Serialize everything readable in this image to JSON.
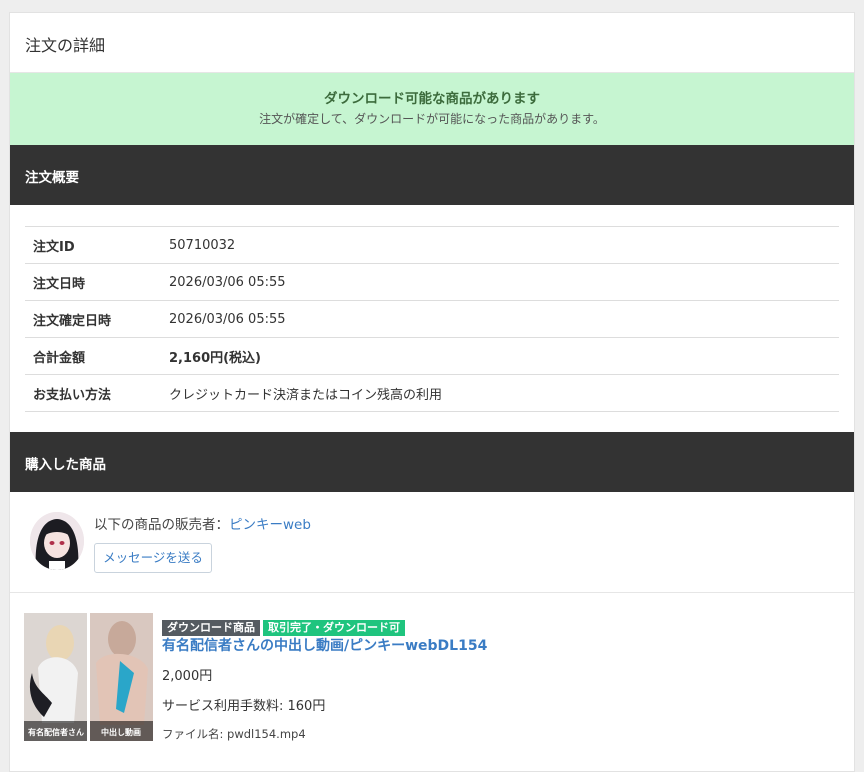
{
  "page": {
    "title": "注文の詳細"
  },
  "alert": {
    "title": "ダウンロード可能な商品があります",
    "body": "注文が確定して、ダウンロードが可能になった商品があります。",
    "background": "#c6f5d1"
  },
  "summary": {
    "header": "注文概要",
    "rows": [
      {
        "label": "注文ID",
        "value": "50710032"
      },
      {
        "label": "注文日時",
        "value": "2026/03/06 05:55"
      },
      {
        "label": "注文確定日時",
        "value": "2026/03/06 05:55"
      },
      {
        "label": "合計金額",
        "value": "2,160円(税込)"
      },
      {
        "label": "お支払い方法",
        "value": "クレジットカード決済またはコイン残高の利用"
      }
    ]
  },
  "purchased": {
    "header": "購入した商品",
    "seller_prefix": "以下の商品の販売者：",
    "seller_name": "ピンキーweb",
    "message_button": "メッセージを送る",
    "product": {
      "badges": [
        "ダウンロード商品",
        "取引完了・ダウンロード可"
      ],
      "thumb_captions": [
        "有名配信者さん",
        "中出し動画"
      ],
      "title": "有名配信者さんの中出し動画/ピンキーwebDL154",
      "price": "2,000円",
      "fee": "サービス利用手数料: 160円",
      "file": "ファイル名: pwdl154.mp4"
    }
  },
  "colors": {
    "header_bg": "#333333",
    "link": "#3a7cc4",
    "badge_gray": "#555b61",
    "badge_green": "#1fc47e"
  }
}
